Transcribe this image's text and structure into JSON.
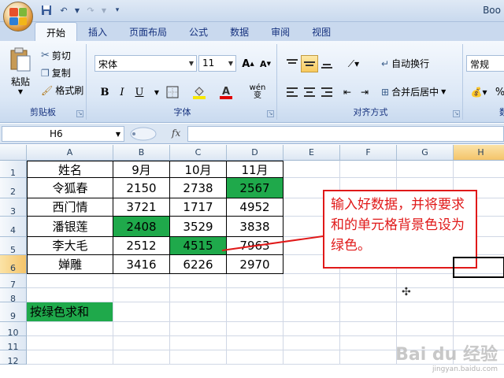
{
  "window": {
    "title": "Boo"
  },
  "ribbon_tabs": [
    "开始",
    "插入",
    "页面布局",
    "公式",
    "数据",
    "审阅",
    "视图"
  ],
  "clipboard": {
    "paste": "粘贴",
    "cut": "剪切",
    "copy": "复制",
    "format_painter": "格式刷",
    "group_label": "剪贴板"
  },
  "font": {
    "name": "宋体",
    "size": "11",
    "bold": "B",
    "italic": "I",
    "underline": "U",
    "grow": "A",
    "shrink": "A",
    "phonetic": "wén 变",
    "group_label": "字体"
  },
  "alignment": {
    "wrap_text": "自动换行",
    "merge_center": "合并后居中",
    "group_label": "对齐方式"
  },
  "number": {
    "format": "常规",
    "group_label": "数"
  },
  "formula_bar": {
    "name_box": "H6",
    "fx": "fx",
    "value": ""
  },
  "columns": [
    "A",
    "B",
    "C",
    "D",
    "E",
    "F",
    "G",
    "H"
  ],
  "rows": [
    "1",
    "2",
    "3",
    "4",
    "5",
    "6",
    "7",
    "8",
    "9",
    "10",
    "11",
    "12"
  ],
  "table": {
    "header": [
      "姓名",
      "9月",
      "10月",
      "11月"
    ],
    "data": [
      [
        "令狐春",
        "2150",
        "2738",
        "2567"
      ],
      [
        "西门情",
        "3721",
        "1717",
        "4952"
      ],
      [
        "潘银莲",
        "2408",
        "3529",
        "3838"
      ],
      [
        "李大毛",
        "2512",
        "4515",
        "7963"
      ],
      [
        "婵雕",
        "3416",
        "6226",
        "2970"
      ]
    ]
  },
  "label_cell": "按绿色求和",
  "callout": {
    "text": "输入好数据，并将要求和的单元格背景色设为绿色。"
  },
  "watermark": {
    "main": "Bai du 经验",
    "sub": "jingyan.baidu.com"
  },
  "colors": {
    "green_fill": "#1fa94b",
    "callout_red": "#e01919"
  }
}
